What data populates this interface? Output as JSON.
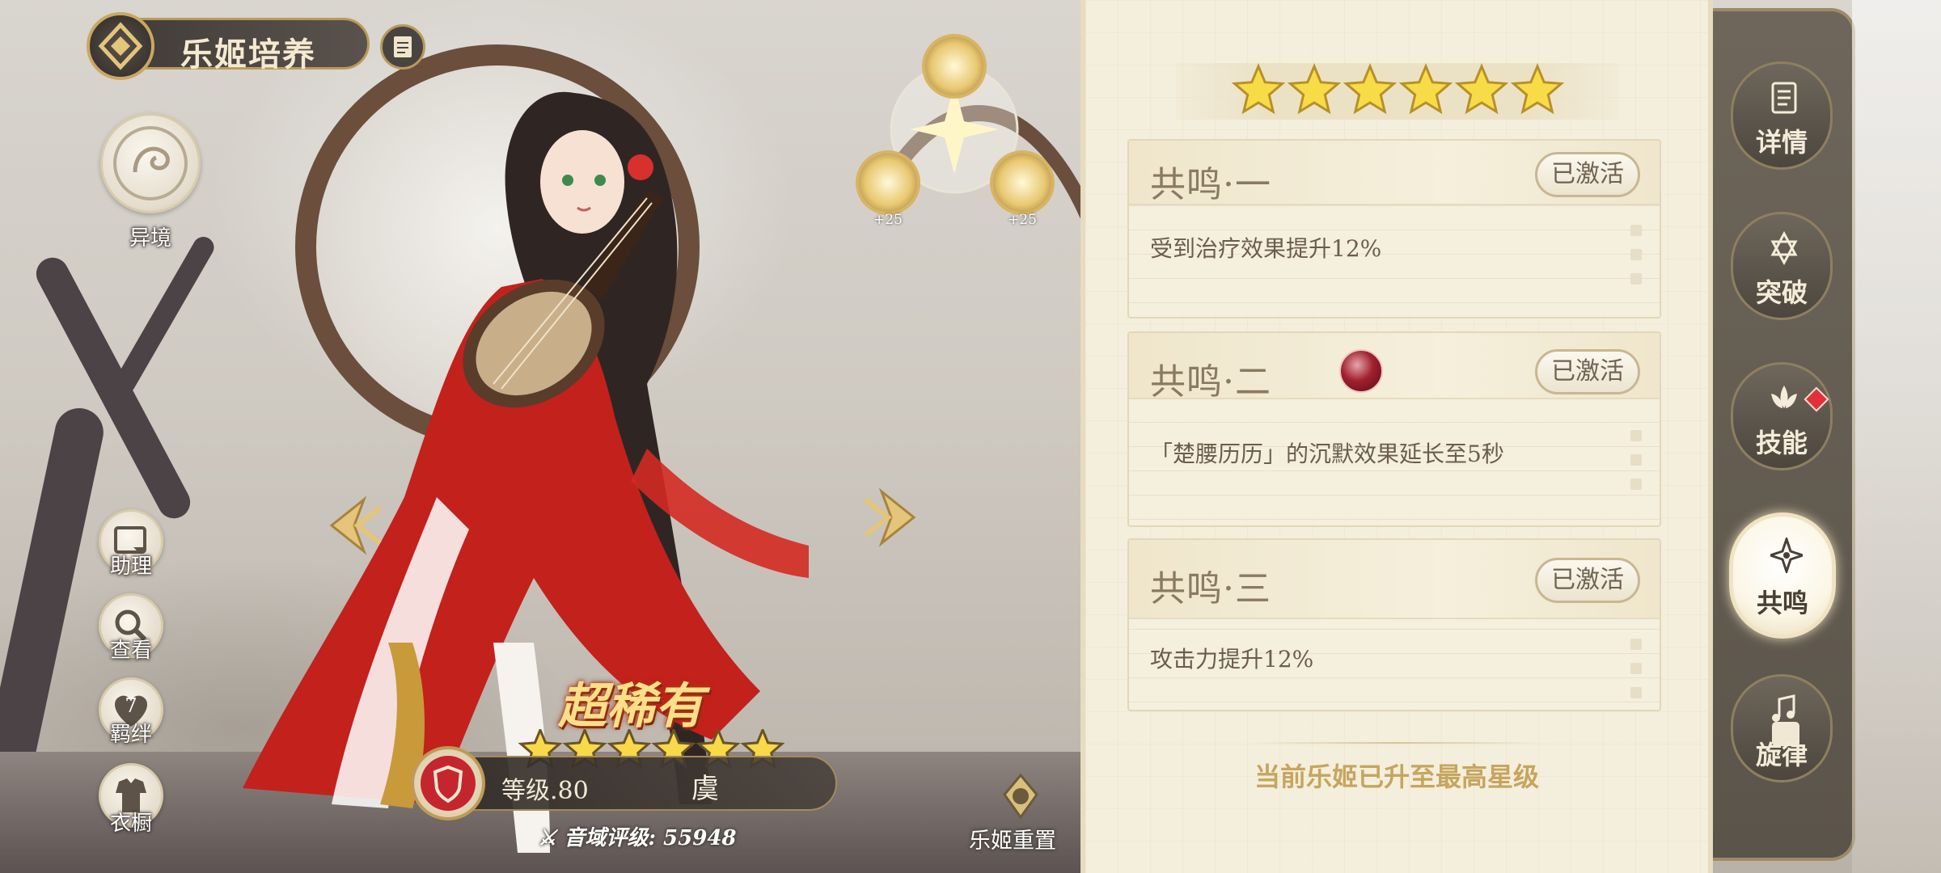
{
  "header": {
    "title": "乐姬培养"
  },
  "left_buttons": {
    "yijing": "异境",
    "assistant": "助理",
    "view": "查看",
    "bond": "羁绊",
    "bond_count": "7",
    "wardrobe": "衣橱"
  },
  "skill_crystals": {
    "left_plus": "+25",
    "right_plus": "+25"
  },
  "character": {
    "rarity": "超稀有",
    "stars": 6,
    "level_text": "等级.80",
    "name": "虞",
    "rating_label": "音域评级:",
    "rating_value": "55948"
  },
  "reset": {
    "label": "乐姬重置"
  },
  "panel": {
    "stars": 6,
    "resonances": [
      {
        "title": "共鸣·一",
        "status": "已激活",
        "desc": "受到治疗效果提升12%",
        "has_orb": false
      },
      {
        "title": "共鸣·二",
        "status": "已激活",
        "desc": "「楚腰历历」的沉默效果延长至5秒",
        "has_orb": true
      },
      {
        "title": "共鸣·三",
        "status": "已激活",
        "desc": "攻击力提升12%",
        "has_orb": false
      }
    ],
    "footer": "当前乐姬已升至最高星级"
  },
  "tabs": [
    {
      "label": "详情",
      "icon": "scroll-icon",
      "active": false
    },
    {
      "label": "突破",
      "icon": "hexagram-icon",
      "active": false
    },
    {
      "label": "技能",
      "icon": "leaf-crown-icon",
      "active": false,
      "alert": true
    },
    {
      "label": "共鸣",
      "icon": "sparkle-star-icon",
      "active": true
    },
    {
      "label": "旋律",
      "icon": "music-lock-icon",
      "active": false,
      "locked": true
    }
  ],
  "colors": {
    "accent_gold": "#c6a55e",
    "panel_bg": "#f4eedc",
    "tab_bg": "#5b544a",
    "alert_red": "#e0303a"
  }
}
